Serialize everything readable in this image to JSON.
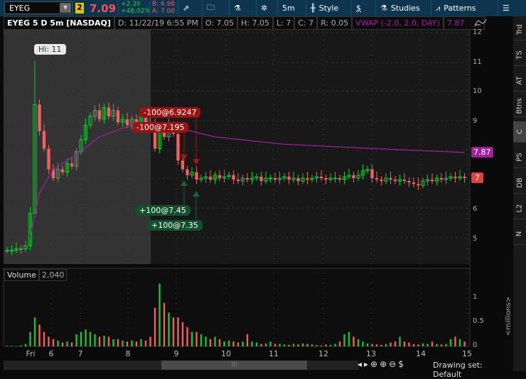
{
  "toolbar": {
    "symbol": "EYEG",
    "link_badge": "2",
    "last": "7.09",
    "change": "+2.30",
    "change_pct": "+48.02%",
    "bid": "B: 6.98",
    "ask": "A: 7.00",
    "aggregation": "5m",
    "style": "Style",
    "studies": "Studies",
    "patterns": "Patterns",
    "dollar": "$"
  },
  "info": {
    "title": "EYEG 5 D 5m [NASDAQ]",
    "date": "D: 11/22/19 6:55 PM",
    "open": "O: 7.05",
    "high": "H: 7.05",
    "low": "L: 7",
    "close": "C: 7",
    "range": "R: 0.05",
    "vwap_label": "VWAP (-2.0, 2.0, DAY)",
    "vwap_value": "7.87"
  },
  "price_axis": [
    "12",
    "11",
    "10",
    "9",
    "8",
    "7",
    "6",
    "5"
  ],
  "price_tags": {
    "vwap": "7.87",
    "last": "7"
  },
  "hi_bubble": "Hi: 11",
  "orders": {
    "sell1": "-100@6.9247",
    "sell2": "-100@7.195",
    "buy1": "+100@7.45",
    "buy2": "+100@7.35"
  },
  "volume": {
    "label": "Volume",
    "value": "2,040",
    "axis": [
      "1",
      "0.5",
      "0"
    ],
    "unit": "<millions>"
  },
  "x_axis": [
    "Fri",
    "6",
    "7",
    "8",
    "9",
    "10",
    "11",
    "12",
    "13",
    "14",
    "15"
  ],
  "right_tabs": [
    "Trd",
    "TS",
    "AT",
    "Btns",
    "C",
    "PS",
    "DB",
    "L2",
    "N"
  ],
  "selected_tab": "C",
  "bottom": {
    "drawing_set": "Drawing set: Default"
  },
  "colors": {
    "up": "#1fbf3a",
    "down": "#f06060",
    "vwap": "#a020a0",
    "toolbar": "#0e3550"
  },
  "chart_data": {
    "type": "candlestick",
    "closes": [
      4.55,
      4.55,
      4.6,
      4.6,
      4.7,
      5.8,
      9.5,
      8.6,
      8.0,
      7.3,
      7.0,
      7.3,
      7.2,
      7.5,
      7.4,
      7.9,
      8.3,
      8.8,
      9.1,
      9.3,
      9.0,
      9.4,
      9.1,
      9.3,
      8.9,
      9.0,
      8.8,
      9.0,
      8.9,
      9.1,
      8.9,
      8.8,
      8.0,
      8.6,
      8.4,
      8.8,
      8.5,
      7.6,
      7.3,
      7.1,
      7.2,
      6.95,
      7.0,
      7.05,
      6.95,
      7.1,
      7.0,
      7.05,
      7.1,
      6.95,
      6.9,
      7.0,
      6.95,
      7.0,
      7.05,
      6.9,
      7.0,
      7.0,
      6.95,
      7.0,
      7.05,
      6.95,
      7.0,
      6.9,
      7.0,
      6.95,
      7.0,
      7.05,
      7.0,
      6.95,
      7.0,
      7.0,
      6.95,
      7.05,
      7.1,
      7.0,
      7.1,
      7.25,
      7.3,
      7.0,
      6.95,
      6.9,
      7.0,
      6.95,
      6.9,
      6.95,
      6.9,
      6.85,
      6.8,
      6.75,
      6.9,
      6.95,
      6.9,
      7.0,
      6.95,
      7.0,
      7.05,
      7.0,
      7.05,
      7.0
    ],
    "volumes": [
      0.01,
      0.01,
      0.01,
      0.02,
      0.05,
      0.3,
      0.6,
      0.45,
      0.3,
      0.2,
      0.15,
      0.12,
      0.08,
      0.1,
      0.08,
      0.25,
      0.3,
      0.35,
      0.3,
      0.25,
      0.2,
      0.22,
      0.2,
      0.15,
      0.15,
      0.12,
      0.1,
      0.12,
      0.1,
      0.15,
      0.12,
      0.2,
      0.8,
      1.3,
      0.9,
      0.7,
      0.6,
      0.6,
      0.5,
      0.4,
      0.3,
      0.3,
      0.25,
      0.2,
      0.15,
      0.2,
      0.15,
      0.1,
      0.12,
      0.1,
      0.08,
      0.1,
      0.25,
      0.1,
      0.08,
      0.05,
      0.06,
      0.1,
      0.05,
      0.05,
      0.04,
      0.03,
      0.05,
      0.04,
      0.06,
      0.05,
      0.04,
      0.03,
      0.02,
      0.04,
      0.03,
      0.05,
      0.1,
      0.25,
      0.3,
      0.2,
      0.15,
      0.1,
      0.06,
      0.05,
      0.04,
      0.03,
      0.05,
      0.08,
      0.1,
      0.2,
      0.1,
      0.08,
      0.05,
      0.04,
      0.06,
      0.05,
      0.1,
      0.05,
      0.04,
      0.05,
      0.15,
      0.2,
      0.15,
      0.1
    ],
    "vwap": [
      [
        5,
        5.0
      ],
      [
        7,
        6.5
      ],
      [
        10,
        7.3
      ],
      [
        15,
        7.8
      ],
      [
        20,
        8.4
      ],
      [
        25,
        8.7
      ],
      [
        31,
        8.9
      ],
      [
        37,
        8.7
      ],
      [
        45,
        8.4
      ],
      [
        60,
        8.15
      ],
      [
        80,
        8.0
      ],
      [
        99,
        7.87
      ]
    ],
    "ylim": [
      4.2,
      12.4
    ]
  }
}
